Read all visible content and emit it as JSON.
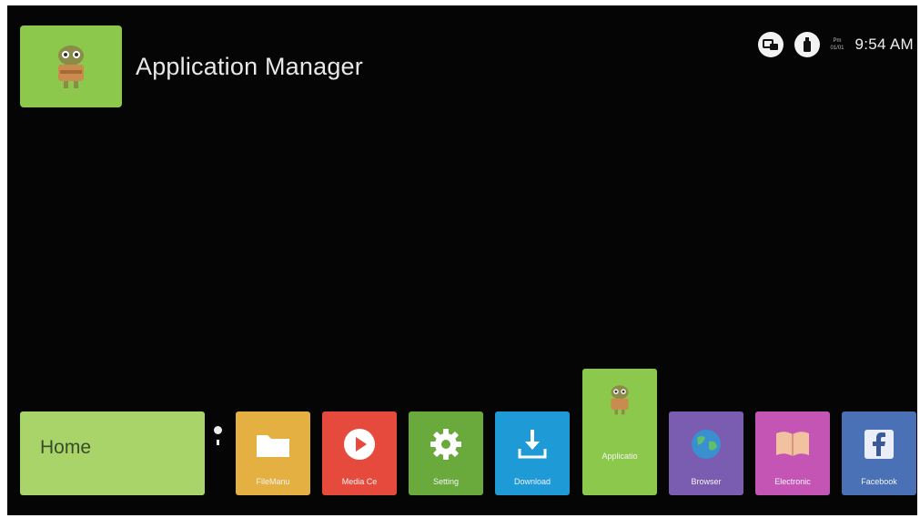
{
  "header": {
    "title": "Application Manager",
    "app_icon": "android-icon"
  },
  "status_bar": {
    "icons": [
      "network-icon",
      "usb-icon"
    ],
    "date_top": "Pm",
    "date_bottom": "01/01",
    "time": "9:54 AM"
  },
  "dock": {
    "home_label": "Home",
    "apps": [
      {
        "label": "FileManu",
        "icon": "folder-icon",
        "color": "#e4b042"
      },
      {
        "label": "Media Ce",
        "icon": "play-icon",
        "color": "#e64a3c"
      },
      {
        "label": "Setting",
        "icon": "gear-icon",
        "color": "#6aaa3c"
      },
      {
        "label": "Download",
        "icon": "download-icon",
        "color": "#1e9ad6"
      },
      {
        "label": "Applicatio",
        "icon": "android-icon",
        "color": "#8cc84b",
        "selected": true
      },
      {
        "label": "Browser",
        "icon": "globe-icon",
        "color": "#7a5cb0"
      },
      {
        "label": "Electronic",
        "icon": "book-icon",
        "color": "#c455b5"
      },
      {
        "label": "Facebook",
        "icon": "facebook-icon",
        "color": "#4a70b6"
      }
    ]
  },
  "colors": {
    "background": "#050505",
    "home_tile": "#a8d46a"
  }
}
